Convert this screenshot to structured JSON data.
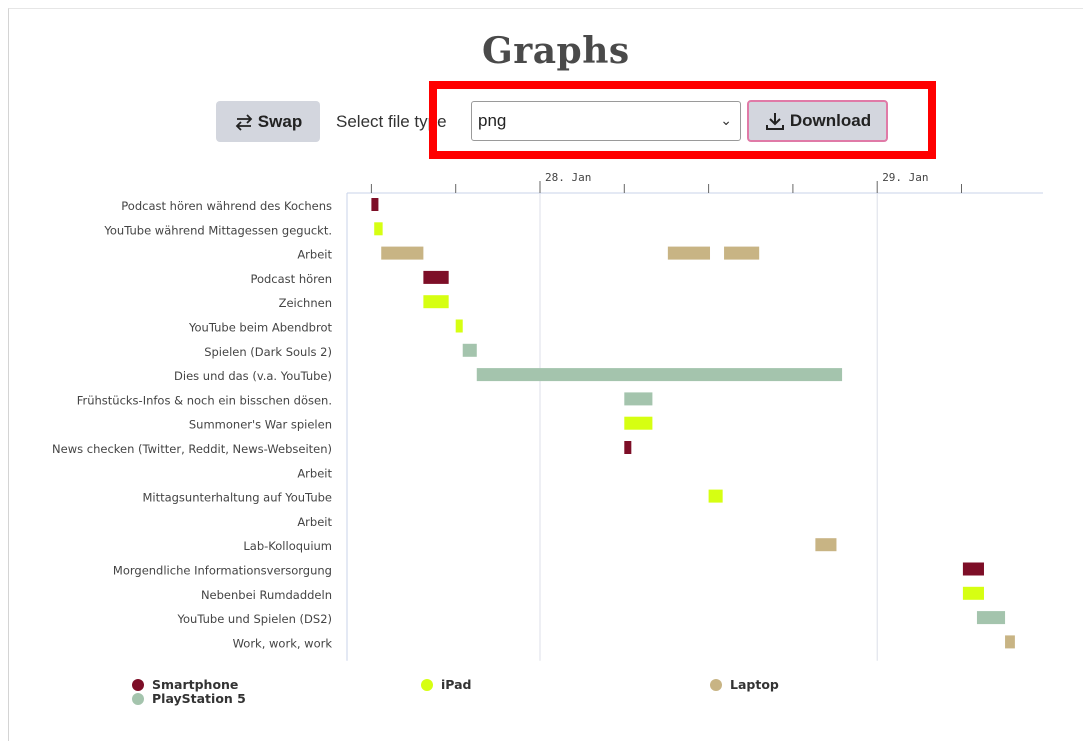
{
  "page": {
    "title": "Graphs",
    "swap_label": "Swap",
    "file_type_label": "Select file type",
    "file_type_value": "png",
    "download_label": "Download"
  },
  "colors": {
    "smartphone": "#7d0e27",
    "ipad": "#d6ff12",
    "laptop": "#c8b484",
    "playstation": "#a4c4ad",
    "highlight": "#ff0000"
  },
  "legend": [
    {
      "label": "Smartphone",
      "color": "#7d0e27"
    },
    {
      "label": "PlayStation 5",
      "color": "#a4c4ad"
    },
    {
      "label": "iPad",
      "color": "#d6ff12"
    },
    {
      "label": "Laptop",
      "color": "#c8b484"
    }
  ],
  "chart_data": {
    "type": "gantt",
    "x_tick_labels": [
      "28. Jan",
      "29. Jan"
    ],
    "x_unit": "hours relative to 28. Jan 00:00",
    "xlim": [
      -19.2,
      31.4
    ],
    "rows": [
      "Podcast hören während des Kochens",
      "YouTube während Mittagessen geguckt.",
      "Arbeit",
      "Podcast hören",
      "Zeichnen",
      "YouTube beim Abendbrot",
      "Spielen (Dark Souls 2)",
      "Dies und das (v.a. YouTube)",
      "Frühstücks-Infos & noch ein bisschen dösen.",
      "Summoner's War spielen",
      "News checken (Twitter, Reddit, News-Webseiten)",
      "Arbeit",
      "Mittagsunterhaltung auf YouTube",
      "Arbeit",
      "Lab-Kolloquium",
      "Morgendliche Informationsversorgung",
      "Nebenbei Rumdaddeln",
      "YouTube und Spielen (DS2)",
      "Work, work, work"
    ],
    "tasks": [
      {
        "row": 0,
        "start": -12.0,
        "end": -11.5,
        "device": "smartphone"
      },
      {
        "row": 1,
        "start": -11.8,
        "end": -11.2,
        "device": "ipad"
      },
      {
        "row": 2,
        "start": -11.3,
        "end": -8.3,
        "device": "laptop"
      },
      {
        "row": 2,
        "start": 9.1,
        "end": 12.1,
        "device": "laptop"
      },
      {
        "row": 2,
        "start": 13.1,
        "end": 15.6,
        "device": "laptop"
      },
      {
        "row": 3,
        "start": -8.3,
        "end": -6.5,
        "device": "smartphone"
      },
      {
        "row": 4,
        "start": -8.3,
        "end": -6.5,
        "device": "ipad"
      },
      {
        "row": 5,
        "start": -6.0,
        "end": -5.5,
        "device": "ipad"
      },
      {
        "row": 6,
        "start": -5.5,
        "end": -4.5,
        "device": "playstation"
      },
      {
        "row": 7,
        "start": -4.5,
        "end": 21.5,
        "device": "playstation"
      },
      {
        "row": 8,
        "start": 6.0,
        "end": 8.0,
        "device": "playstation"
      },
      {
        "row": 9,
        "start": 6.0,
        "end": 8.0,
        "device": "ipad"
      },
      {
        "row": 10,
        "start": 6.0,
        "end": 6.5,
        "device": "smartphone"
      },
      {
        "row": 12,
        "start": 12.0,
        "end": 13.0,
        "device": "ipad"
      },
      {
        "row": 14,
        "start": 19.6,
        "end": 21.1,
        "device": "laptop"
      },
      {
        "row": 15,
        "start": 30.1,
        "end": 31.6,
        "device": "smartphone"
      },
      {
        "row": 16,
        "start": 30.1,
        "end": 31.6,
        "device": "ipad"
      },
      {
        "row": 17,
        "start": 31.1,
        "end": 33.1,
        "device": "playstation"
      },
      {
        "row": 18,
        "start": 33.1,
        "end": 33.8,
        "device": "laptop"
      }
    ]
  }
}
